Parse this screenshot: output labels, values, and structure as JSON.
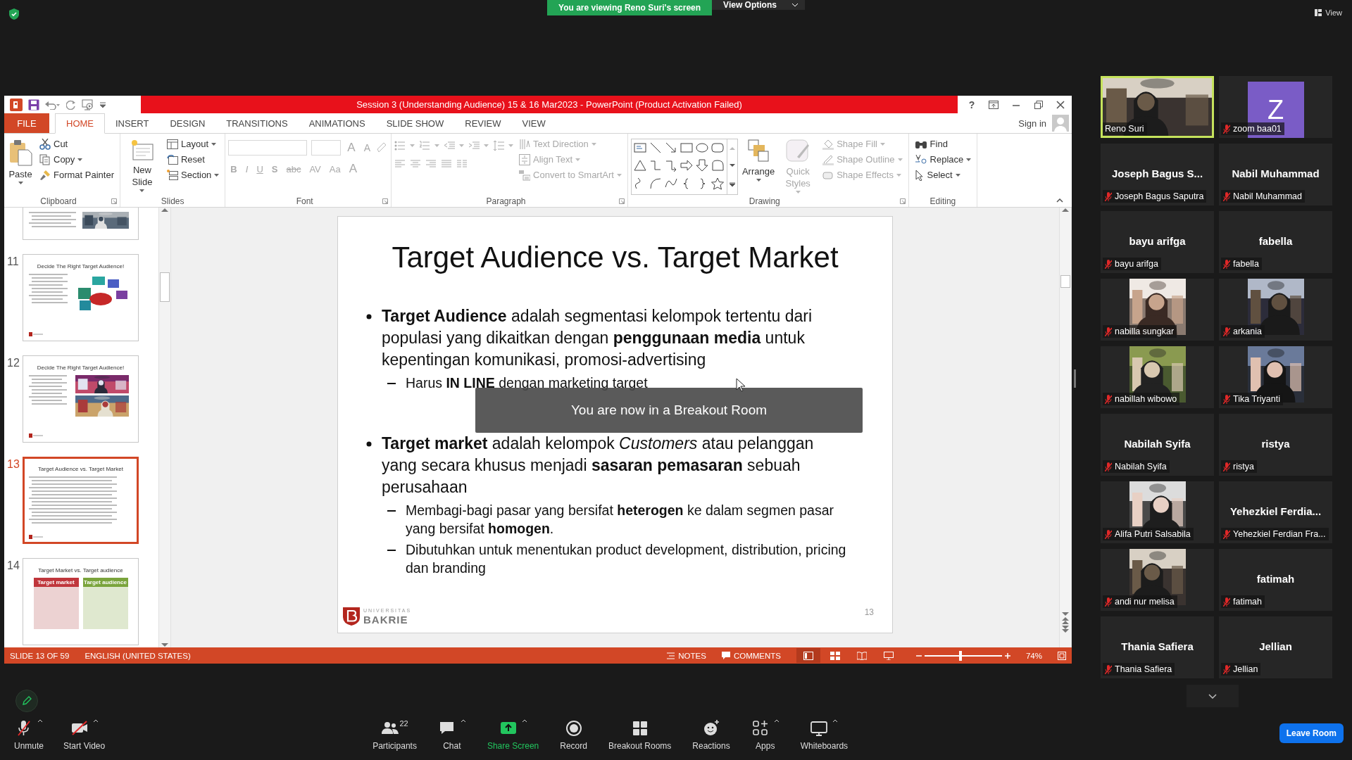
{
  "meeting_bar": {
    "banner": "You are viewing Reno Suri's screen",
    "view_options": "View Options",
    "view": "View"
  },
  "ppt": {
    "title": "Session 3 (Understanding Audience) 15 & 16 Mar2023 -  PowerPoint (Product Activation Failed)",
    "help": "?",
    "tabs": [
      {
        "label": "FILE",
        "kind": "file",
        "selected": false
      },
      {
        "label": "HOME",
        "kind": "tab",
        "selected": true
      },
      {
        "label": "INSERT",
        "kind": "tab",
        "selected": false
      },
      {
        "label": "DESIGN",
        "kind": "tab",
        "selected": false
      },
      {
        "label": "TRANSITIONS",
        "kind": "tab",
        "selected": false
      },
      {
        "label": "ANIMATIONS",
        "kind": "tab",
        "selected": false
      },
      {
        "label": "SLIDE SHOW",
        "kind": "tab",
        "selected": false
      },
      {
        "label": "REVIEW",
        "kind": "tab",
        "selected": false
      },
      {
        "label": "VIEW",
        "kind": "tab",
        "selected": false
      }
    ],
    "sign_in": "Sign in",
    "ribbon": [
      {
        "label": "Clipboard",
        "launcher": true,
        "columns": [
          {
            "kind": "large",
            "items": [
              {
                "label": "Paste",
                "kind": "paste",
                "dropdown": true,
                "disabled": false
              }
            ]
          },
          {
            "kind": "small",
            "items": [
              {
                "label": "Cut",
                "kind": "cut",
                "dropdown": false,
                "disabled": false
              },
              {
                "label": "Copy",
                "kind": "copy",
                "dropdown": true,
                "disabled": false
              },
              {
                "label": "Format Painter",
                "kind": "painter",
                "dropdown": false,
                "disabled": false
              }
            ]
          }
        ]
      },
      {
        "label": "Slides",
        "launcher": false,
        "columns": [
          {
            "kind": "large",
            "items": [
              {
                "label": "New Slide",
                "kind": "newslide",
                "dropdown": true,
                "disabled": false
              }
            ]
          },
          {
            "kind": "small",
            "items": [
              {
                "label": "Layout",
                "kind": "layout",
                "dropdown": true,
                "disabled": false
              },
              {
                "label": "Reset",
                "kind": "reset",
                "dropdown": false,
                "disabled": false
              },
              {
                "label": "Section",
                "kind": "section",
                "dropdown": true,
                "disabled": false
              }
            ]
          }
        ]
      },
      {
        "label": "Font",
        "launcher": true,
        "columns": [
          {
            "kind": "font",
            "disabled": true,
            "row1": [
              "A",
              "A"
            ],
            "row2": [
              "B",
              "I",
              "U",
              "S",
              "abc",
              "AV",
              "Aa",
              "A"
            ]
          }
        ]
      },
      {
        "label": "Paragraph",
        "launcher": true,
        "columns": [
          {
            "kind": "para",
            "disabled": true
          },
          {
            "kind": "small",
            "items": [
              {
                "label": "Text Direction",
                "kind": "textdir",
                "dropdown": true,
                "disabled": true
              },
              {
                "label": "Align Text",
                "kind": "aligntext",
                "dropdown": true,
                "disabled": true
              },
              {
                "label": "Convert to SmartArt",
                "kind": "smartart",
                "dropdown": true,
                "disabled": true
              }
            ]
          }
        ]
      },
      {
        "label": "Drawing",
        "launcher": true,
        "columns": [
          {
            "kind": "gallery",
            "disabled": false
          },
          {
            "kind": "large",
            "items": [
              {
                "label": "Arrange",
                "kind": "arrange",
                "dropdown": true,
                "disabled": false
              }
            ]
          },
          {
            "kind": "large",
            "items": [
              {
                "label": "Quick Styles",
                "kind": "quickstyles",
                "dropdown": true,
                "disabled": true
              }
            ]
          },
          {
            "kind": "small",
            "items": [
              {
                "label": "Shape Fill",
                "kind": "fill",
                "dropdown": true,
                "disabled": true
              },
              {
                "label": "Shape Outline",
                "kind": "outline",
                "dropdown": true,
                "disabled": true
              },
              {
                "label": "Shape Effects",
                "kind": "effects",
                "dropdown": true,
                "disabled": true
              }
            ]
          }
        ]
      },
      {
        "label": "Editing",
        "launcher": false,
        "columns": [
          {
            "kind": "small",
            "items": [
              {
                "label": "Find",
                "kind": "find",
                "dropdown": false,
                "disabled": false
              },
              {
                "label": "Replace",
                "kind": "replace",
                "dropdown": true,
                "disabled": false
              },
              {
                "label": "Select",
                "kind": "select",
                "dropdown": true,
                "disabled": false
              }
            ]
          }
        ]
      }
    ],
    "thumbnails": [
      {
        "kind": "partial",
        "selected": false
      },
      {
        "number": "11",
        "kind": "picture",
        "title": "Decide The Right Target Audience!",
        "selected": false
      },
      {
        "number": "12",
        "kind": "picture",
        "title": "Decide The Right Target Audience!",
        "selected": false
      },
      {
        "number": "13",
        "kind": "text",
        "title": "Target Audience vs. Target Market",
        "selected": true
      },
      {
        "number": "14",
        "kind": "columns",
        "title": "Target Market vs. Target audience",
        "columns": [
          "Target market",
          "Target audience"
        ],
        "selected": false
      }
    ],
    "slide": {
      "title": "Target Audience vs. Target Market",
      "bullets": [
        {
          "text": "**Target Audience** adalah segmentasi kelompok tertentu dari populasi yang dikaitkan dengan **penggunaan media** untuk kepentingan komunikasi, promosi-advertising",
          "subs": [
            "Harus **IN LINE** dengan marketing target"
          ]
        },
        {
          "text": "**Target market** adalah kelompok *Customers*  atau pelanggan yang secara khusus menjadi **sasaran pemasaran** sebuah perusahaan",
          "subs": [
            "Membagi-bagi pasar yang bersifat **heterogen** ke dalam segmen pasar yang bersifat **homogen**.",
            "Dibutuhkan untuk menentukan product development, distribution, pricing dan branding"
          ]
        }
      ],
      "logo_top": "UNIVERSITAS",
      "logo_main": "BAKRIE",
      "page": "13"
    },
    "status": {
      "slide": "SLIDE 13 OF 59",
      "language": "ENGLISH (UNITED STATES)",
      "notes": "NOTES",
      "comments": "COMMENTS",
      "views": [
        {
          "selected": true
        },
        {
          "selected": false
        },
        {
          "selected": false
        },
        {
          "selected": false
        }
      ],
      "zoom": {
        "level": 0.45
      },
      "zoom_text": "74%"
    }
  },
  "overlay": "You are now in a Breakout Room",
  "participants": [
    {
      "kind": "video",
      "name": "Reno Suri",
      "muted": false,
      "speaking": true
    },
    {
      "kind": "avatar",
      "letter": "Z",
      "name": "zoom baa01",
      "muted": true,
      "speaking": false
    },
    {
      "kind": "name",
      "big_name": "Joseph Bagus S...",
      "name": "Joseph Bagus Saputra",
      "muted": true,
      "speaking": false
    },
    {
      "kind": "name",
      "big_name": "Nabil Muhammad",
      "name": "Nabil Muhammad",
      "muted": true,
      "speaking": false
    },
    {
      "kind": "name",
      "big_name": "bayu arifga",
      "name": "bayu arifga",
      "muted": true,
      "speaking": false
    },
    {
      "kind": "name",
      "big_name": "fabella",
      "name": "fabella",
      "muted": true,
      "speaking": false
    },
    {
      "name": "nabilla sungkar",
      "muted": true,
      "speaking": false
    },
    {
      "name": "arkania",
      "muted": true,
      "speaking": false
    },
    {
      "name": "nabillah wibowo",
      "muted": true,
      "speaking": false
    },
    {
      "name": "Tika Triyanti",
      "muted": true,
      "speaking": false
    },
    {
      "kind": "name",
      "big_name": "Nabilah Syifa",
      "name": "Nabilah Syifa",
      "muted": true,
      "speaking": false
    },
    {
      "kind": "name",
      "big_name": "ristya",
      "name": "ristya",
      "muted": true,
      "speaking": false
    },
    {
      "name": "Alifa Putri Salsabila",
      "muted": true,
      "speaking": false
    },
    {
      "kind": "name",
      "big_name": "Yehezkiel  Ferdia...",
      "name": "Yehezkiel Ferdian Fra...",
      "muted": true,
      "speaking": false
    },
    {
      "name": "andi nur melisa",
      "muted": true,
      "speaking": false
    },
    {
      "kind": "name",
      "big_name": "fatimah",
      "name": "fatimah",
      "muted": true,
      "speaking": false
    },
    {
      "kind": "name",
      "big_name": "Thania Safiera",
      "name": "Thania Safiera",
      "muted": true,
      "speaking": false
    },
    {
      "kind": "name",
      "big_name": "Jellian",
      "name": "Jellian",
      "muted": true,
      "speaking": false
    }
  ],
  "toolbar": {
    "left": [
      {
        "label": "Unmute",
        "kind": "mic",
        "caret": true
      },
      {
        "label": "Start Video",
        "kind": "video",
        "caret": true
      }
    ],
    "center": [
      {
        "label": "Participants",
        "kind": "participants",
        "badge": "22",
        "caret": false
      },
      {
        "label": "Chat",
        "kind": "chat",
        "caret": true
      },
      {
        "label": "Share Screen",
        "kind": "share",
        "caret": true
      },
      {
        "label": "Record",
        "kind": "record",
        "caret": false
      },
      {
        "label": "Breakout Rooms",
        "kind": "breakout",
        "caret": false
      },
      {
        "label": "Reactions",
        "kind": "reactions",
        "caret": false
      },
      {
        "label": "Apps",
        "kind": "apps",
        "caret": true
      },
      {
        "label": "Whiteboards",
        "kind": "whiteboard",
        "caret": true
      }
    ],
    "leave": "Leave Room"
  }
}
